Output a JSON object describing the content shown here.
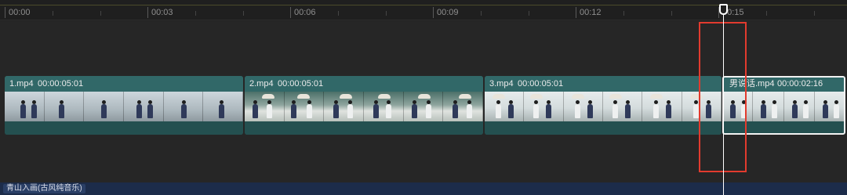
{
  "ruler": {
    "ticks": [
      "00:00",
      "00:03",
      "00:06",
      "00:09",
      "00:12",
      "00:15"
    ]
  },
  "clips": [
    {
      "name": "1.mp4",
      "duration": "00:00:05:01"
    },
    {
      "name": "2.mp4",
      "duration": "00:00:05:01"
    },
    {
      "name": "3.mp4",
      "duration": "00:00:05:01"
    },
    {
      "name": "男说话.mp4",
      "duration": "00:00:02:16"
    }
  ],
  "audio": {
    "name": "青山入画(古风纯音乐)"
  },
  "colors": {
    "video_clip": "#2b5d5d",
    "playhead": "#ffffff",
    "highlight_box": "#e23b2e",
    "audio_track": "#1c2c4a"
  }
}
